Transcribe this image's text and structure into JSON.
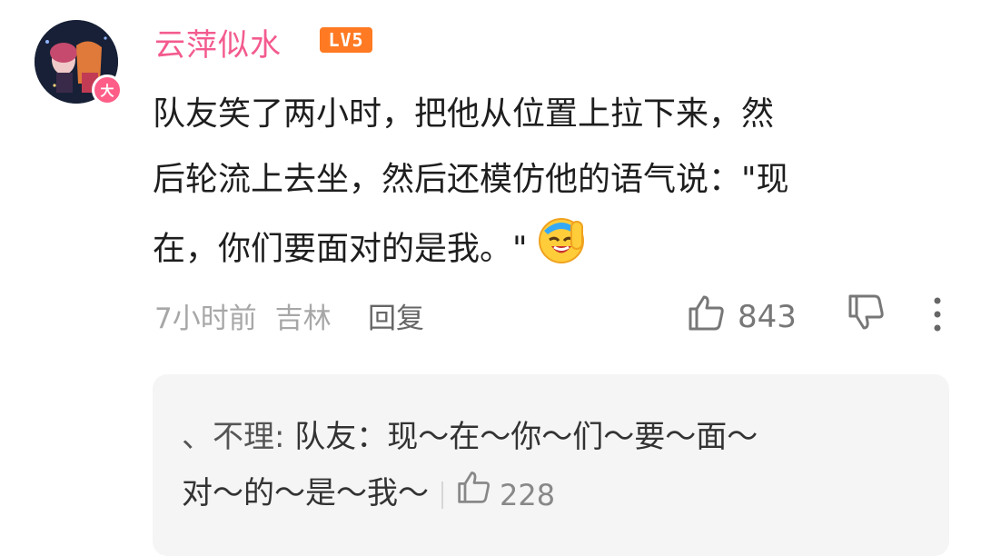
{
  "user": {
    "name": "云萍似水",
    "level": "LV5",
    "badge": "大"
  },
  "comment": {
    "lines": [
      "队友笑了两小时，把他从位置上拉下来，然",
      "后轮流上去坐，然后还模仿他的语气说：\"现",
      "在，你们要面对的是我。\""
    ],
    "emoji": "laughing-face-emoji"
  },
  "meta": {
    "time": "7小时前",
    "location": "吉林",
    "reply_label": "回复"
  },
  "actions": {
    "like_count": "843"
  },
  "reply": {
    "author": "、不理:",
    "text_line1": "队友：现～在～你～们～要～面～",
    "text_line2": "对～的～是～我～",
    "like_count": "228"
  },
  "colors": {
    "username": "#f35b8f",
    "level_badge": "#ff7a22",
    "reply_bg": "#f5f5f6"
  }
}
